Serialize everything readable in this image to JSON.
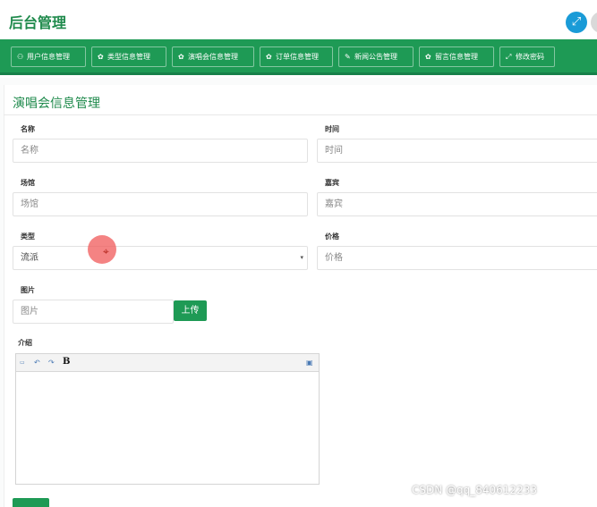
{
  "app": {
    "title": "后台管理",
    "expand_icon": "expand-icon"
  },
  "nav": {
    "items": [
      {
        "label": "用户信息管理",
        "icon": "user-icon"
      },
      {
        "label": "类型信息管理",
        "icon": "gear-icon"
      },
      {
        "label": "演唱会信息管理",
        "icon": "gear-icon"
      },
      {
        "label": "订单信息管理",
        "icon": "gear-icon"
      },
      {
        "label": "新闻公告管理",
        "icon": "edit-icon"
      },
      {
        "label": "留言信息管理",
        "icon": "gear-icon"
      },
      {
        "label": "修改密码",
        "icon": "arrows-icon"
      }
    ],
    "color": "#1e9a55"
  },
  "page": {
    "title": "演唱会信息管理"
  },
  "form": {
    "name": {
      "label": "名称",
      "placeholder": "名称"
    },
    "time": {
      "label": "时间",
      "placeholder": "时间"
    },
    "venue": {
      "label": "场馆",
      "placeholder": "场馆"
    },
    "guest": {
      "label": "嘉宾",
      "placeholder": "嘉宾"
    },
    "type": {
      "label": "类型",
      "value": "流派"
    },
    "price": {
      "label": "价格",
      "placeholder": "价格"
    },
    "image": {
      "label": "图片",
      "placeholder": "图片",
      "upload_label": "上传"
    },
    "intro": {
      "label": "介绍",
      "editor_bold_label": "B"
    }
  },
  "watermark": "CSDN @qq_840612233"
}
